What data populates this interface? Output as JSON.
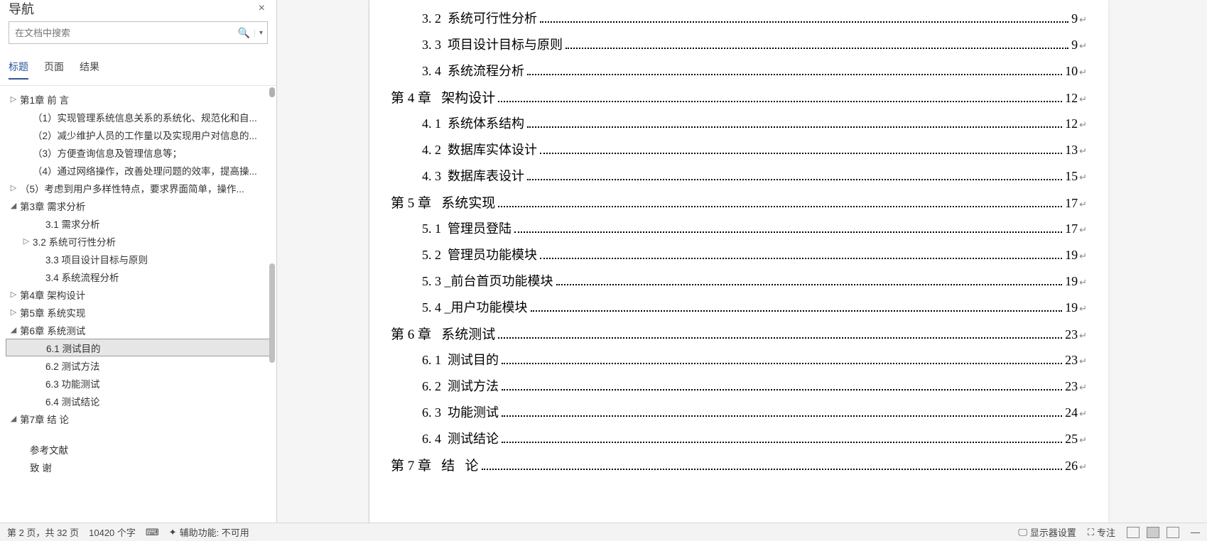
{
  "nav": {
    "title": "导航",
    "close": "×",
    "search_placeholder": "在文档中搜索",
    "tabs": [
      "标题",
      "页面",
      "结果"
    ],
    "active_tab": 0,
    "tree": [
      {
        "level": 1,
        "tw": "▷",
        "text": "第1章 前 言",
        "sel": false
      },
      {
        "level": 2,
        "tw": "",
        "text": "（1）实现管理系统信息关系的系统化、规范化和自...",
        "sel": false
      },
      {
        "level": 2,
        "tw": "",
        "text": "（2）减少维护人员的工作量以及实现用户对信息的...",
        "sel": false
      },
      {
        "level": 2,
        "tw": "",
        "text": "（3）方便查询信息及管理信息等；",
        "sel": false
      },
      {
        "level": 2,
        "tw": "",
        "text": "（4）通过网络操作，改善处理问题的效率，提高操...",
        "sel": false
      },
      {
        "level": 1,
        "tw": "▷",
        "text": "（5）考虑到用户多样性特点，要求界面简单，操作...",
        "sel": false
      },
      {
        "level": 1,
        "tw": "◢",
        "text": "第3章  需求分析",
        "sel": false
      },
      {
        "level": 3,
        "tw": "",
        "text": "3.1 需求分析",
        "sel": false
      },
      {
        "level": 2,
        "tw": "▷",
        "text": "3.2  系统可行性分析",
        "sel": false
      },
      {
        "level": 3,
        "tw": "",
        "text": "3.3 项目设计目标与原则",
        "sel": false
      },
      {
        "level": 3,
        "tw": "",
        "text": "3.4 系统流程分析",
        "sel": false
      },
      {
        "level": 1,
        "tw": "▷",
        "text": "第4章  架构设计",
        "sel": false
      },
      {
        "level": 1,
        "tw": "▷",
        "text": "第5章  系统实现",
        "sel": false
      },
      {
        "level": 1,
        "tw": "◢",
        "text": "第6章  系统测试",
        "sel": false
      },
      {
        "level": 3,
        "tw": "",
        "text": "6.1 测试目的",
        "sel": true
      },
      {
        "level": 3,
        "tw": "",
        "text": "6.2 测试方法",
        "sel": false
      },
      {
        "level": 3,
        "tw": "",
        "text": "6.3 功能测试",
        "sel": false
      },
      {
        "level": 3,
        "tw": "",
        "text": "6.4 测试结论",
        "sel": false
      },
      {
        "level": 1,
        "tw": "◢",
        "text": "第7章 结  论",
        "sel": false
      },
      {
        "level": 1,
        "tw": "",
        "text": "",
        "sel": false,
        "blank": true
      },
      {
        "level": 1,
        "tw": "",
        "text": "参考文献",
        "sel": false,
        "noind": true
      },
      {
        "level": 1,
        "tw": "",
        "text": "致  谢",
        "sel": false,
        "noind": true
      }
    ]
  },
  "toc": [
    {
      "lvl": 2,
      "num": "3. 2",
      "title": "  系统可行性分析",
      "page": "9"
    },
    {
      "lvl": 2,
      "num": "3. 3",
      "title": "  项目设计目标与原则",
      "page": "9"
    },
    {
      "lvl": 2,
      "num": "3. 4",
      "title": "  系统流程分析",
      "page": "10"
    },
    {
      "lvl": 1,
      "num": "第 4 章",
      "title": "   架构设计",
      "page": "12"
    },
    {
      "lvl": 2,
      "num": "4. 1",
      "title": "  系统体系结构",
      "page": "12"
    },
    {
      "lvl": 2,
      "num": "4. 2",
      "title": "  数据库实体设计",
      "page": "13"
    },
    {
      "lvl": 2,
      "num": "4. 3",
      "title": "  数据库表设计",
      "page": "15"
    },
    {
      "lvl": 1,
      "num": "第 5 章",
      "title": "   系统实现",
      "page": "17"
    },
    {
      "lvl": 2,
      "num": "5. 1",
      "title": "  管理员登陆",
      "page": "17"
    },
    {
      "lvl": 2,
      "num": "5. 2",
      "title": "  管理员功能模块",
      "page": "19"
    },
    {
      "lvl": 2,
      "num": "5. 3",
      "title": " _前台首页功能模块",
      "page": "19"
    },
    {
      "lvl": 2,
      "num": "5. 4",
      "title": " _用户功能模块",
      "page": "19"
    },
    {
      "lvl": 1,
      "num": "第 6 章",
      "title": "   系统测试",
      "page": "23"
    },
    {
      "lvl": 2,
      "num": "6. 1",
      "title": "  测试目的",
      "page": "23"
    },
    {
      "lvl": 2,
      "num": "6. 2",
      "title": "  测试方法",
      "page": "23"
    },
    {
      "lvl": 2,
      "num": "6. 3",
      "title": "  功能测试",
      "page": "24"
    },
    {
      "lvl": 2,
      "num": "6. 4",
      "title": "  测试结论",
      "page": "25"
    },
    {
      "lvl": 1,
      "num": "第 7 章",
      "title": "   结   论",
      "page": "26"
    }
  ],
  "status": {
    "page": "第 2 页，共 32 页",
    "words": "10420 个字",
    "lang_icon": "⌨",
    "a11y": "辅助功能: 不可用",
    "display": "显示器设置",
    "focus": "专注"
  }
}
